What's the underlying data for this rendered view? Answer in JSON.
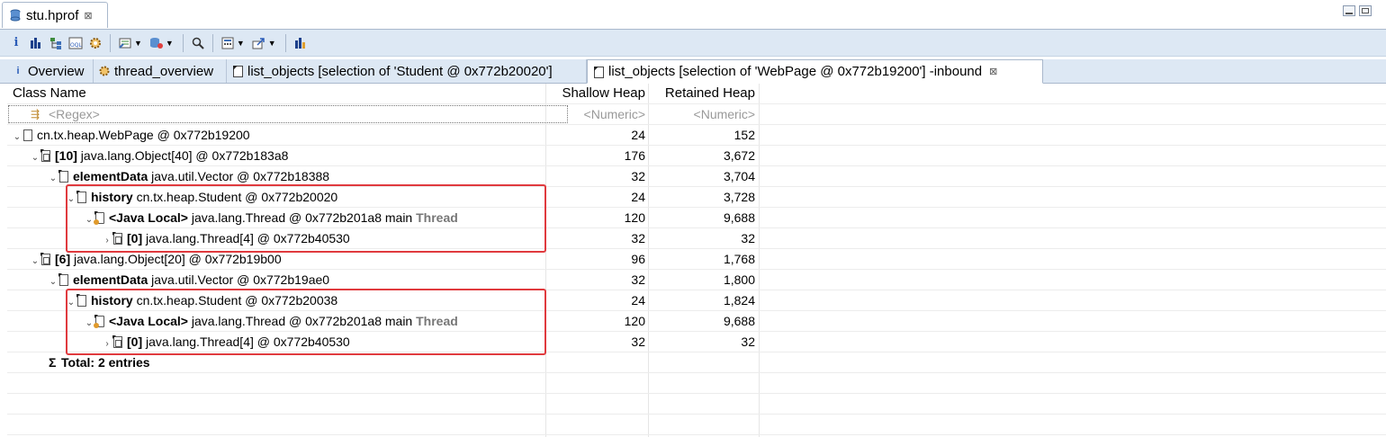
{
  "editor": {
    "tab_title": "stu.hprof",
    "tab_close": "⊠"
  },
  "toolbar": {
    "icons": [
      "info-icon",
      "histogram-icon",
      "dominator-tree-icon",
      "oql-icon",
      "thread-gear-icon",
      "query-browser-icon",
      "heap-dump-icon",
      "search-icon",
      "calculator-icon",
      "export-icon",
      "group-icon"
    ]
  },
  "tabs": [
    {
      "label": "Overview",
      "icon": "info-icon"
    },
    {
      "label": "thread_overview",
      "icon": "gear-icon"
    },
    {
      "label": "list_objects [selection of 'Student @ 0x772b20020']",
      "icon": "list-objects-icon"
    },
    {
      "label": "list_objects [selection of 'WebPage @ 0x772b19200'] -inbound",
      "icon": "list-objects-icon",
      "close": "⊠"
    }
  ],
  "table": {
    "headers": {
      "class_name": "Class Name",
      "shallow": "Shallow Heap",
      "retained": "Retained Heap"
    },
    "filter": {
      "regex": "<Regex>",
      "shallow": "<Numeric>",
      "retained": "<Numeric>"
    },
    "rows": [
      {
        "toggle": "⌄",
        "prefix": "",
        "name": "cn.tx.heap.WebPage @ 0x772b19200",
        "suffix": "",
        "shallow": "24",
        "retained": "152"
      },
      {
        "toggle": "⌄",
        "prefix": "[10]",
        "name": " java.lang.Object[40] @ 0x772b183a8",
        "suffix": "",
        "shallow": "176",
        "retained": "3,672"
      },
      {
        "toggle": "⌄",
        "prefix": "elementData",
        "name": " java.util.Vector @ 0x772b18388",
        "suffix": "",
        "shallow": "32",
        "retained": "3,704"
      },
      {
        "toggle": "⌄",
        "prefix": "history",
        "name": " cn.tx.heap.Student @ 0x772b20020",
        "suffix": "",
        "shallow": "24",
        "retained": "3,728"
      },
      {
        "toggle": "⌄",
        "prefix": "<Java Local>",
        "name": " java.lang.Thread @ 0x772b201a8  main",
        "suffix": "Thread",
        "shallow": "120",
        "retained": "9,688"
      },
      {
        "toggle": "›",
        "prefix": "[0]",
        "name": " java.lang.Thread[4] @ 0x772b40530",
        "suffix": "",
        "shallow": "32",
        "retained": "32"
      },
      {
        "toggle": "⌄",
        "prefix": "[6]",
        "name": " java.lang.Object[20] @ 0x772b19b00",
        "suffix": "",
        "shallow": "96",
        "retained": "1,768"
      },
      {
        "toggle": "⌄",
        "prefix": "elementData",
        "name": " java.util.Vector @ 0x772b19ae0",
        "suffix": "",
        "shallow": "32",
        "retained": "1,800"
      },
      {
        "toggle": "⌄",
        "prefix": "history",
        "name": " cn.tx.heap.Student @ 0x772b20038",
        "suffix": "",
        "shallow": "24",
        "retained": "1,824"
      },
      {
        "toggle": "⌄",
        "prefix": "<Java Local>",
        "name": " java.lang.Thread @ 0x772b201a8  main",
        "suffix": "Thread",
        "shallow": "120",
        "retained": "9,688"
      },
      {
        "toggle": "›",
        "prefix": "[0]",
        "name": " java.lang.Thread[4] @ 0x772b40530",
        "suffix": "",
        "shallow": "32",
        "retained": "32"
      }
    ],
    "total": {
      "symbol": "Σ",
      "label": "Total: 2 entries"
    }
  },
  "annotation_color": "#e03a3e"
}
